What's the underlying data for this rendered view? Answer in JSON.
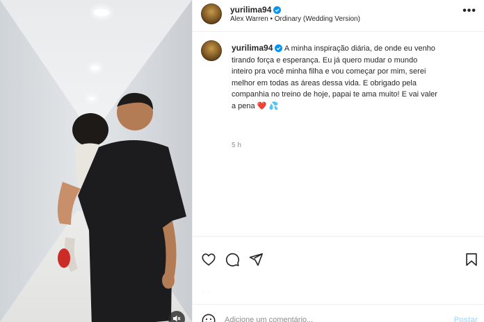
{
  "media": {
    "mute_icon": "speaker-muted-icon"
  },
  "header": {
    "username": "yurilima94",
    "verified_icon": "verified-badge-icon",
    "audio_artist": "Alex Warren",
    "audio_separator": "•",
    "audio_title": "Ordinary (Wedding Version)",
    "more_icon": "more-options-icon"
  },
  "caption": {
    "username": "yurilima94",
    "text": "A minha inspiração diária, de onde eu venho tirando força e esperança. Eu já quero mudar o mundo inteiro pra você minha filha e vou começar por mim, serei melhor em todas as áreas dessa vida. E obrigado pela companhia no treino de hoje, papai te ama muito! E vai valer a pena",
    "emoji_1": "❤️",
    "emoji_2": "💦",
    "time": "5 h"
  },
  "actions": {
    "like_icon": "heart-icon",
    "comment_icon": "comment-icon",
    "share_icon": "send-icon",
    "save_icon": "bookmark-icon"
  },
  "comment": {
    "emoji_icon": "emoji-icon",
    "placeholder": "Adicione um comentário...",
    "post_label": "Postar"
  },
  "colors": {
    "verified": "#0095f6",
    "post_button": "#b2dffc",
    "muted_text": "#8e8e8e"
  }
}
